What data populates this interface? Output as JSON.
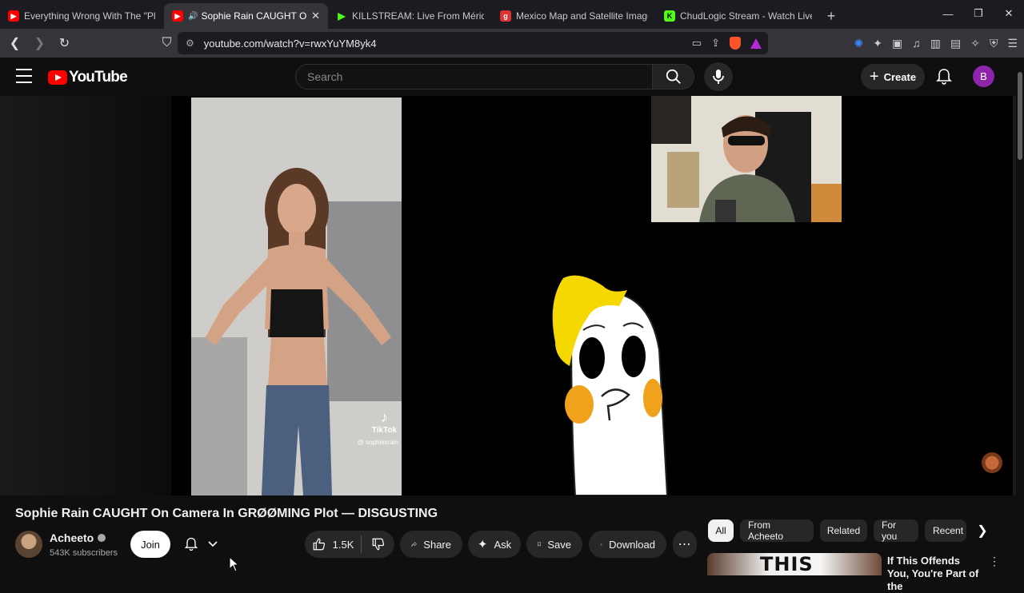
{
  "browser": {
    "tabs": [
      {
        "title": "Everything Wrong With The \"Plus Size",
        "icon": "youtube-icon",
        "active": false
      },
      {
        "title": "Sophie Rain CAUGHT On Cam",
        "icon": "youtube-icon",
        "active": true
      },
      {
        "title": "KILLSTREAM: Live From Mérida, M",
        "icon": "play-icon",
        "active": false
      },
      {
        "title": "Mexico Map and Satellite Image",
        "icon": "map-icon",
        "active": false
      },
      {
        "title": "ChudLogic Stream - Watch Live o",
        "icon": "kick-icon",
        "active": false
      }
    ],
    "url": "youtube.com/watch?v=rwxYuYM8yk4"
  },
  "youtube": {
    "logo_text": "YouTube",
    "search_placeholder": "Search",
    "create_label": "Create",
    "avatar_letter": "B"
  },
  "video": {
    "title": "Sophie Rain CAUGHT On Camera In GRØØMING Plot — DISGUSTING",
    "overlay_brand": "TikTok",
    "overlay_user": "@ sophiexrain"
  },
  "channel": {
    "name": "Acheeto",
    "subscribers": "543K subscribers",
    "join_label": "Join"
  },
  "actions": {
    "likes": "1.5K",
    "share_label": "Share",
    "ask_label": "Ask",
    "save_label": "Save",
    "download_label": "Download"
  },
  "chips": [
    "All",
    "From Acheeto",
    "Related",
    "For you",
    "Recent"
  ],
  "related": {
    "thumb_text": "THIS",
    "title": "If This Offends You, You're Part of the"
  },
  "colors": {
    "yt_red": "#ff0000",
    "bg": "#0f0f0f",
    "pill": "#272727"
  }
}
